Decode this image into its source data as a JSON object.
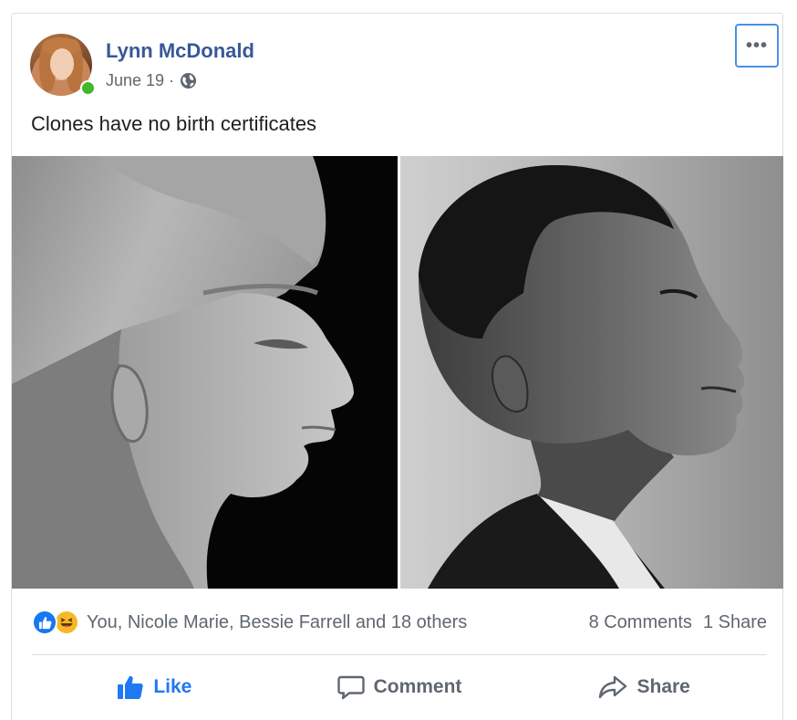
{
  "post": {
    "author": "Lynn McDonald",
    "date": "June 19 ·",
    "text": "Clones have no birth certificates",
    "more_icon": "more-options-icon"
  },
  "reactions": {
    "icons": [
      "like-reaction-icon",
      "haha-reaction-icon"
    ],
    "names": "You, Nicole Marie, Bessie Farrell and 18 others",
    "comments": "8 Comments",
    "shares": "1 Share"
  },
  "actions": {
    "like": "Like",
    "comment": "Comment",
    "share": "Share"
  },
  "colors": {
    "name_link": "#385898",
    "liked_blue": "#2078f4",
    "online_green": "#42b72a",
    "focus_border": "#4a8fe7"
  }
}
